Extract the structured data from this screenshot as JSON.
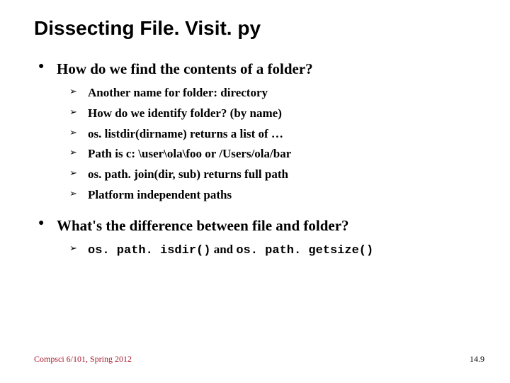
{
  "title": "Dissecting File. Visit. py",
  "bullets": [
    {
      "text": "How do we find the contents of a folder?",
      "subs": [
        "Another name for folder: directory",
        "How do we identify folder? (by name)",
        "os. listdir(dirname) returns a list of …",
        "Path is c: \\user\\ola\\foo or /Users/ola/bar",
        "os. path. join(dir, sub) returns full path",
        "Platform independent paths"
      ]
    },
    {
      "text": "What's the difference between file and folder?",
      "subs": []
    }
  ],
  "code_sub": {
    "code1": "os. path. isdir()",
    "mid": " and ",
    "code2": "os. path. getsize()"
  },
  "footer": {
    "left": "Compsci 6/101, Spring 2012",
    "right": "14.9"
  }
}
